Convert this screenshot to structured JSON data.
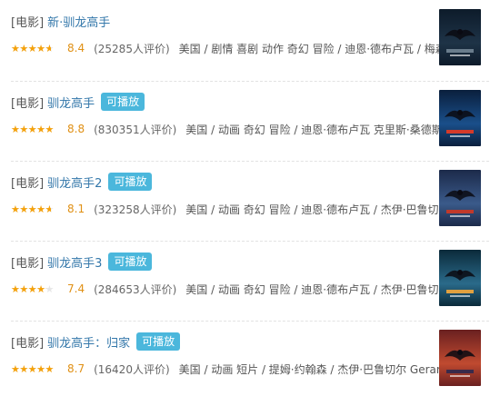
{
  "results": [
    {
      "category": "[电影]",
      "title": "新·驯龙高手",
      "playable": false,
      "play_label": "",
      "rating_fraction": 0.8,
      "rating": "8.4",
      "votes": "(25285人评价)",
      "subject": "美国 / 剧情 喜剧 动作 奇幻 冒险 / 迪恩·德布卢瓦 / 梅森 ...",
      "poster_colors": [
        "#0d1b2a",
        "#1e3347",
        "#6a7d8c"
      ],
      "poster_icon": "dragon-rider-silhouette"
    },
    {
      "category": "[电影]",
      "title": "驯龙高手",
      "playable": true,
      "play_label": "可播放",
      "rating_fraction": 0.9,
      "rating": "8.8",
      "votes": "(830351人评价)",
      "subject": "美国 / 动画 奇幻 冒险 / 迪恩·德布卢瓦 克里斯·桑德斯 / ...",
      "poster_colors": [
        "#0a1f3d",
        "#1a4f8a",
        "#d43a2a"
      ],
      "poster_icon": "night-fury-dragon"
    },
    {
      "category": "[电影]",
      "title": "驯龙高手2",
      "playable": true,
      "play_label": "可播放",
      "rating_fraction": 0.8,
      "rating": "8.1",
      "votes": "(323258人评价)",
      "subject": "美国 / 动画 奇幻 冒险 / 迪恩·德布卢瓦 / 杰伊·巴鲁切尔 / ...",
      "poster_colors": [
        "#1c2a4a",
        "#3a5a8a",
        "#c0392b"
      ],
      "poster_icon": "night-fury-dragon"
    },
    {
      "category": "[电影]",
      "title": "驯龙高手3",
      "playable": true,
      "play_label": "可播放",
      "rating_fraction": 0.7,
      "rating": "7.4",
      "votes": "(284653人评价)",
      "subject": "美国 / 动画 奇幻 冒险 / 迪恩·德布卢瓦 / 杰伊·巴鲁切尔 / ...",
      "poster_colors": [
        "#0b2a3a",
        "#2a6a8a",
        "#e0a040"
      ],
      "poster_icon": "two-dragons"
    },
    {
      "category": "[电影]",
      "title": "驯龙高手：归家",
      "playable": true,
      "play_label": "可播放",
      "rating_fraction": 0.9,
      "rating": "8.7",
      "votes": "(16420人评价)",
      "subject": "美国 / 动画 短片 / 提姆·约翰森 / 杰伊·巴鲁切尔 Gerard ...",
      "poster_colors": [
        "#6a2020",
        "#c04a30",
        "#3a2a4a"
      ],
      "poster_icon": "holiday-dragons"
    }
  ],
  "colors": {
    "link": "#3377aa",
    "badge": "#4bb7dc",
    "star": "#f5a10a"
  }
}
